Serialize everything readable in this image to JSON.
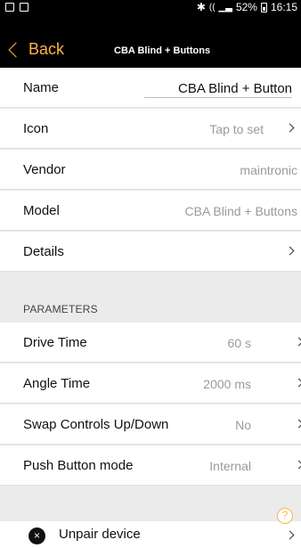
{
  "status_bar": {
    "battery": "52%",
    "time": "16:15",
    "icons": [
      "gallery-icon",
      "clipboard-icon",
      "bluetooth-icon",
      "wifi-icon",
      "signal-icon",
      "battery-icon"
    ]
  },
  "nav": {
    "back_label": "Back",
    "title": "CBA Blind + Buttons"
  },
  "device": {
    "name_label": "Name",
    "name_value": "CBA Blind + Button",
    "icon_label": "Icon",
    "icon_value": "Tap to set",
    "vendor_label": "Vendor",
    "vendor_value": "maintronic",
    "model_label": "Model",
    "model_value": "CBA Blind + Buttons",
    "details_label": "Details"
  },
  "parameters": {
    "section_title": "PARAMETERS",
    "items": [
      {
        "label": "Drive Time",
        "value": "60 s"
      },
      {
        "label": "Angle Time",
        "value": "2000 ms"
      },
      {
        "label": "Swap Controls Up/Down",
        "value": "No"
      },
      {
        "label": "Push Button mode",
        "value": "Internal"
      }
    ]
  },
  "actions": {
    "unpair_label": "Unpair device",
    "unpair_icon": "×",
    "help_icon": "?"
  },
  "colors": {
    "accent": "#ffb347",
    "background": "#ebebeb",
    "row": "#ffffff"
  }
}
